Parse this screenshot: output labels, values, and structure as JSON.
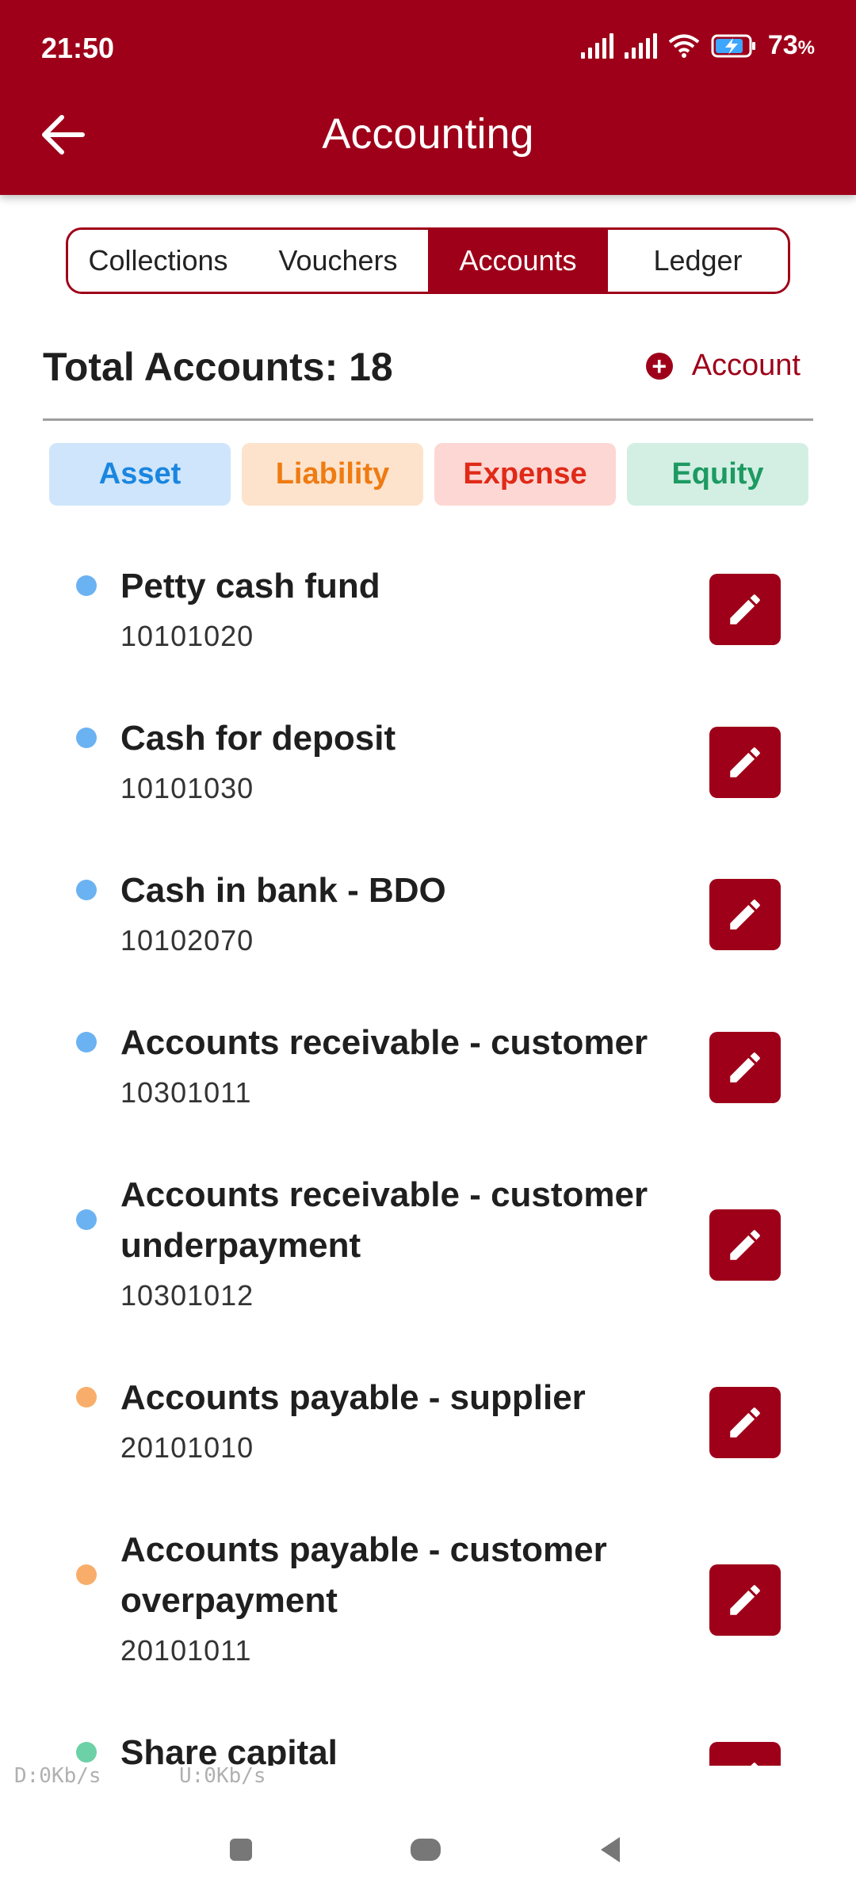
{
  "status_bar": {
    "time": "21:50",
    "battery_percent": "73",
    "battery_unit": "%"
  },
  "header": {
    "title": "Accounting"
  },
  "tabs": [
    {
      "label": "Collections",
      "active": false
    },
    {
      "label": "Vouchers",
      "active": false
    },
    {
      "label": "Accounts",
      "active": true
    },
    {
      "label": "Ledger",
      "active": false
    }
  ],
  "summary": {
    "total_label": "Total Accounts: 18",
    "add_label": "Account"
  },
  "filters": [
    {
      "label": "Asset",
      "bg": "#cfe5fb",
      "fg": "#1a86e0"
    },
    {
      "label": "Liability",
      "bg": "#fde3cc",
      "fg": "#ef7b12"
    },
    {
      "label": "Expense",
      "bg": "#fdd7d4",
      "fg": "#e02a18"
    },
    {
      "label": "Equity",
      "bg": "#d3efe3",
      "fg": "#1d9a62"
    }
  ],
  "accounts": [
    {
      "name": "Petty cash fund",
      "code": "10101020",
      "type": "asset",
      "color": "#6bb2f2"
    },
    {
      "name": "Cash for deposit",
      "code": "10101030",
      "type": "asset",
      "color": "#6bb2f2"
    },
    {
      "name": "Cash in bank - BDO",
      "code": "10102070",
      "type": "asset",
      "color": "#6bb2f2"
    },
    {
      "name": "Accounts receivable - customer",
      "code": "10301011",
      "type": "asset",
      "color": "#6bb2f2"
    },
    {
      "name": "Accounts receivable - customer underpayment",
      "code": "10301012",
      "type": "asset",
      "color": "#6bb2f2"
    },
    {
      "name": "Accounts payable - supplier",
      "code": "20101010",
      "type": "liability",
      "color": "#f8ae6a"
    },
    {
      "name": "Accounts payable - customer overpayment",
      "code": "20101011",
      "type": "liability",
      "color": "#f8ae6a"
    },
    {
      "name": "Share capital",
      "code": "",
      "type": "equity",
      "color": "#6cd1a6"
    }
  ],
  "overlay": {
    "download": "D:0Kb/s",
    "upload": "U:0Kb/s"
  },
  "colors": {
    "brand": "#9e0019"
  }
}
